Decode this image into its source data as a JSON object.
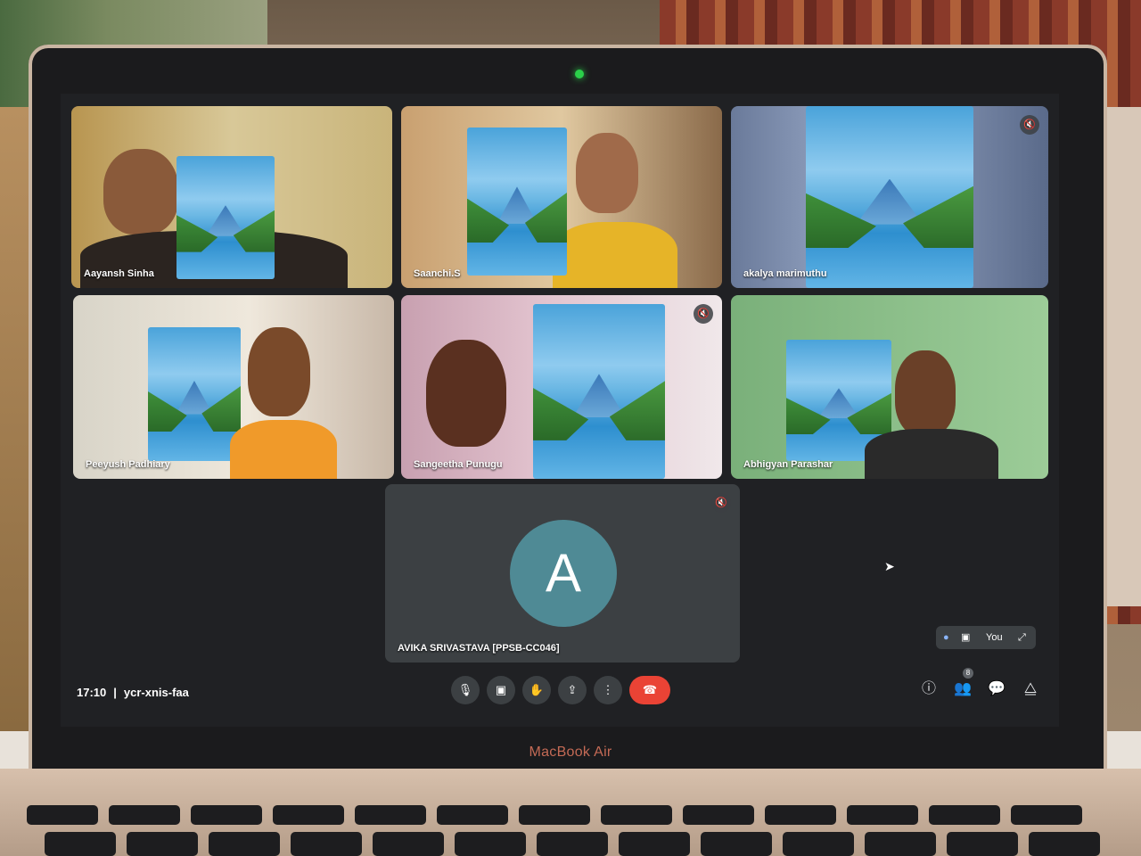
{
  "device": {
    "brand": "MacBook Air"
  },
  "meeting": {
    "time": "17:10",
    "separator": "|",
    "code": "ycr-xnis-faa",
    "participants_count": "8"
  },
  "participants": [
    {
      "name": "Aayansh Sinha",
      "muted": false
    },
    {
      "name": "Saanchi.S",
      "muted": false
    },
    {
      "name": "akalya marimuthu",
      "muted": true
    },
    {
      "name": "Peeyush Padhiary",
      "muted": false
    },
    {
      "name": "Sangeetha Punugu",
      "muted": true
    },
    {
      "name": "Abhigyan Parashar",
      "muted": false
    },
    {
      "name": "AVIKA SRIVASTAVA [PPSB-CC046]",
      "initial": "A",
      "muted": true
    }
  ],
  "self_view": {
    "label": "You"
  },
  "controls": {
    "mic_icon": "microphone-icon",
    "camera_icon": "camera-icon",
    "hand_icon": "raise-hand-icon",
    "present_icon": "present-screen-icon",
    "more_icon": "more-options-icon",
    "end_icon": "end-call-icon",
    "glyphs": {
      "mic": "🎙",
      "camera": "▣",
      "hand": "✋",
      "present": "⇪",
      "more": "⋮",
      "end": "☎"
    }
  },
  "side_icons": {
    "glyphs": {
      "info": "ⓘ",
      "people": "👥",
      "chat": "💬",
      "activities": "⧋",
      "expand": "⤢",
      "mute": "🔇",
      "cursor": "➤"
    }
  },
  "colors": {
    "screen_bg": "#202124",
    "end_call": "#ea4335",
    "avatar": "#4f8a95",
    "camera_led": "#2bd04a"
  }
}
